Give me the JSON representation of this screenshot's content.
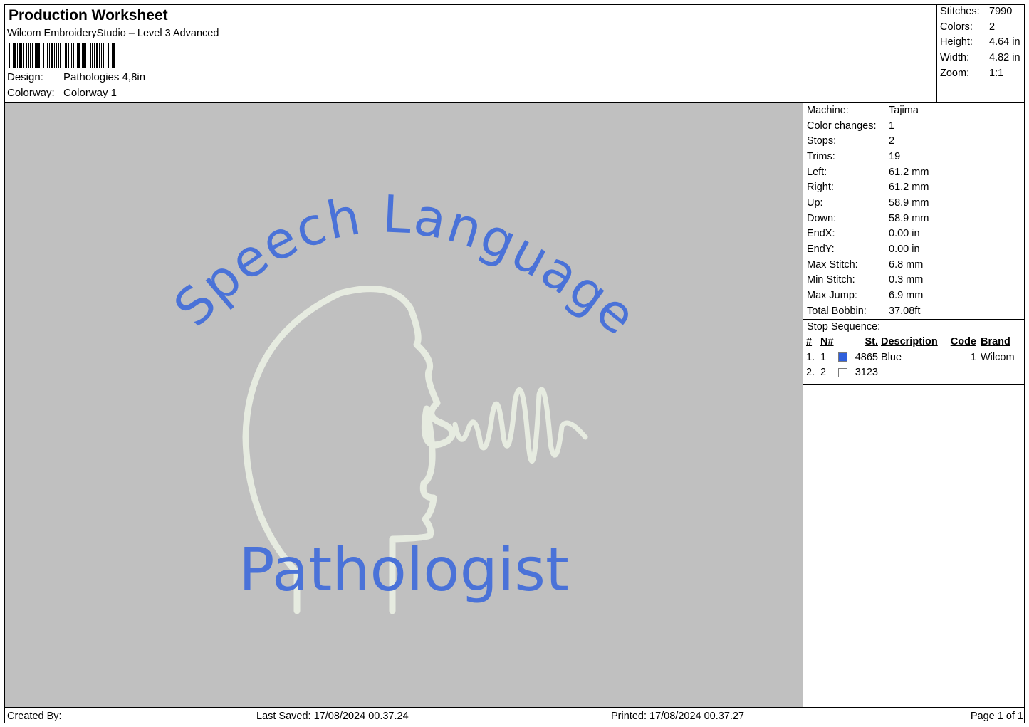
{
  "header": {
    "title": "Production Worksheet",
    "subtitle": "Wilcom EmbroideryStudio – Level 3 Advanced",
    "design_label": "Design:",
    "design_value": "Pathologies 4,8in",
    "colorway_label": "Colorway:",
    "colorway_value": "Colorway 1"
  },
  "stats": [
    {
      "label": "Stitches:",
      "value": "7990"
    },
    {
      "label": "Colors:",
      "value": "2"
    },
    {
      "label": "Height:",
      "value": "4.64 in"
    },
    {
      "label": "Width:",
      "value": "4.82 in"
    },
    {
      "label": "Zoom:",
      "value": "1:1"
    }
  ],
  "machine_info": [
    {
      "label": "Machine:",
      "value": "Tajima"
    },
    {
      "label": "Color changes:",
      "value": "1"
    },
    {
      "label": "Stops:",
      "value": "2"
    },
    {
      "label": "Trims:",
      "value": "19"
    },
    {
      "label": "Left:",
      "value": "61.2 mm"
    },
    {
      "label": "Right:",
      "value": "61.2 mm"
    },
    {
      "label": "Up:",
      "value": "58.9 mm"
    },
    {
      "label": "Down:",
      "value": "58.9 mm"
    },
    {
      "label": "EndX:",
      "value": "0.00 in"
    },
    {
      "label": "EndY:",
      "value": "0.00 in"
    },
    {
      "label": "Max Stitch:",
      "value": "6.8 mm"
    },
    {
      "label": "Min Stitch:",
      "value": "0.3 mm"
    },
    {
      "label": "Max Jump:",
      "value": "6.9 mm"
    },
    {
      "label": "Total Bobbin:",
      "value": "37.08ft"
    }
  ],
  "stop_sequence": {
    "label": "Stop Sequence:",
    "columns": [
      "#",
      "N#",
      "St.",
      "Description",
      "Code",
      "Brand"
    ],
    "rows": [
      {
        "num": "1.",
        "n": "1",
        "color": "#2f5fdc",
        "st": "4865",
        "description": "Blue",
        "code": "1",
        "brand": "Wilcom"
      },
      {
        "num": "2.",
        "n": "2",
        "color": "#ffffff",
        "st": "3123",
        "description": "",
        "code": "",
        "brand": ""
      }
    ]
  },
  "design_art": {
    "text_top": "Speech Language",
    "text_bottom": "Pathologist",
    "thread_blue": "#4a72d8",
    "thread_white": "#e6ebe0",
    "background": "#c0c0c0"
  },
  "footer": {
    "created_by": "Created By:",
    "last_saved": "Last Saved: 17/08/2024 00.37.24",
    "printed": "Printed: 17/08/2024 00.37.27",
    "page": "Page 1 of 1"
  }
}
